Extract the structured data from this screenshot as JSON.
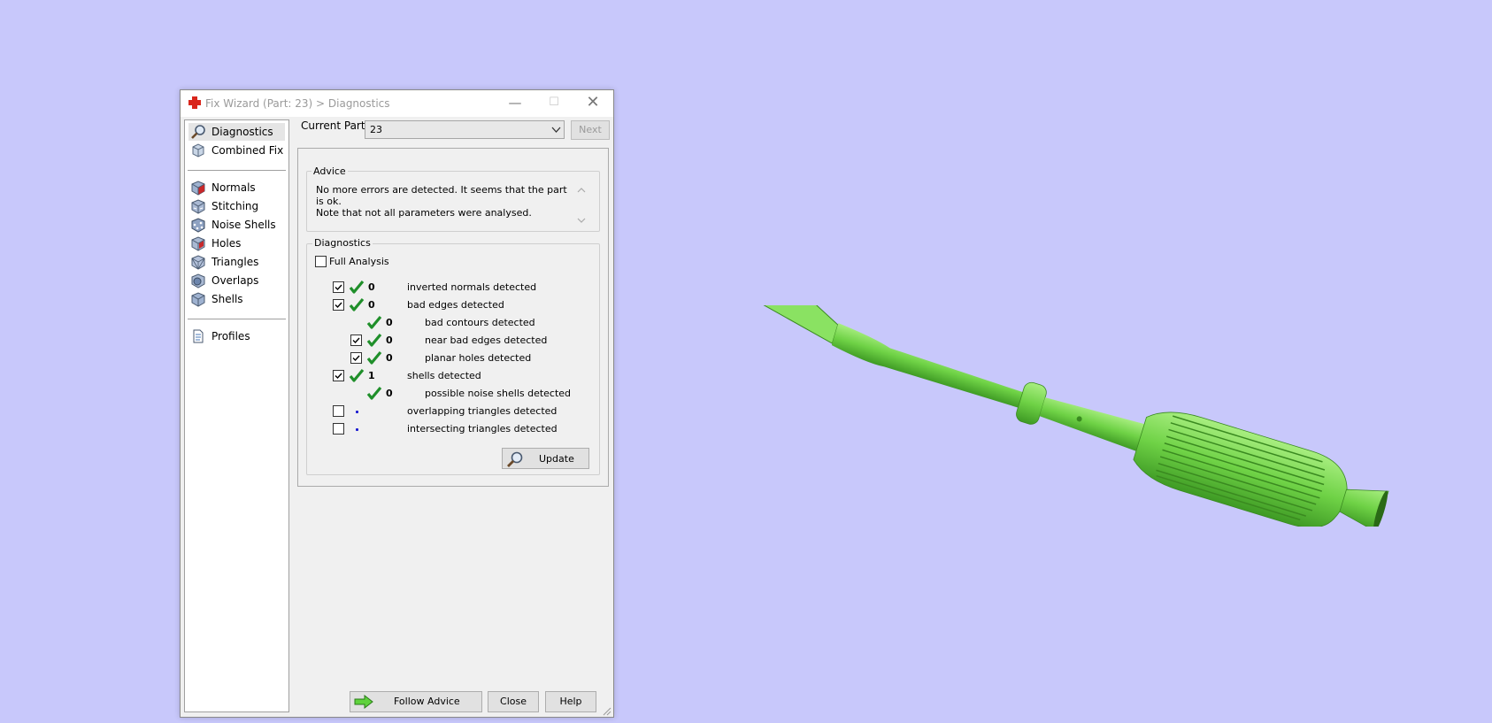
{
  "window": {
    "title": "Fix Wizard (Part: 23) > Diagnostics",
    "minimize_glyph": "—",
    "maximize_glyph": "☐",
    "close_glyph": "✕"
  },
  "nav": {
    "items": [
      {
        "label": "Diagnostics",
        "icon": "magnifier-icon",
        "selected": true
      },
      {
        "label": "Combined Fix",
        "icon": "combined-fix-icon"
      },
      {
        "label": "Normals",
        "icon": "normals-cube-icon"
      },
      {
        "label": "Stitching",
        "icon": "stitching-cube-icon"
      },
      {
        "label": "Noise Shells",
        "icon": "noise-shells-cube-icon"
      },
      {
        "label": "Holes",
        "icon": "holes-cube-icon"
      },
      {
        "label": "Triangles",
        "icon": "triangles-cube-icon"
      },
      {
        "label": "Overlaps",
        "icon": "overlaps-cube-icon"
      },
      {
        "label": "Shells",
        "icon": "shells-cube-icon"
      },
      {
        "label": "Profiles",
        "icon": "profiles-document-icon"
      }
    ]
  },
  "current_part": {
    "label": "Current Part:",
    "value": "23",
    "next_label": "Next"
  },
  "advice": {
    "group_label": "Advice",
    "text_line1": "No more errors are detected. It seems that the part is ok.",
    "text_line2": "Note that not all parameters were analysed."
  },
  "diagnostics": {
    "group_label": "Diagnostics",
    "full_analysis_label": "Full Analysis",
    "full_analysis_checked": false,
    "rows": [
      {
        "checkbox": true,
        "checked": true,
        "status": "ok",
        "count": "0",
        "label": "inverted normals detected",
        "indent": 0
      },
      {
        "checkbox": true,
        "checked": true,
        "status": "ok",
        "count": "0",
        "label": "bad edges detected",
        "indent": 0
      },
      {
        "checkbox": false,
        "status": "ok",
        "count": "0",
        "label": "bad contours detected",
        "indent": 1
      },
      {
        "checkbox": true,
        "checked": true,
        "status": "ok",
        "count": "0",
        "label": "near bad edges detected",
        "indent": 1
      },
      {
        "checkbox": true,
        "checked": true,
        "status": "ok",
        "count": "0",
        "label": "planar holes detected",
        "indent": 1
      },
      {
        "checkbox": true,
        "checked": true,
        "status": "ok",
        "count": "1",
        "label": "shells detected",
        "indent": 0
      },
      {
        "checkbox": false,
        "status": "ok",
        "count": "0",
        "label": "possible noise shells detected",
        "indent": 1
      },
      {
        "checkbox": true,
        "checked": false,
        "status": "not-analysed",
        "count": "",
        "label": "overlapping triangles detected",
        "indent": 0
      },
      {
        "checkbox": true,
        "checked": false,
        "status": "not-analysed",
        "count": "",
        "label": "intersecting triangles detected",
        "indent": 0
      }
    ],
    "update_label": "Update"
  },
  "footer": {
    "follow_advice_label": "Follow Advice",
    "close_label": "Close",
    "help_label": "Help"
  },
  "colors": {
    "background": "#c8c8fb",
    "model_green": "#7ddb55",
    "tick_green": "#1f8f2a",
    "dot_blue": "#1a1ad0"
  }
}
